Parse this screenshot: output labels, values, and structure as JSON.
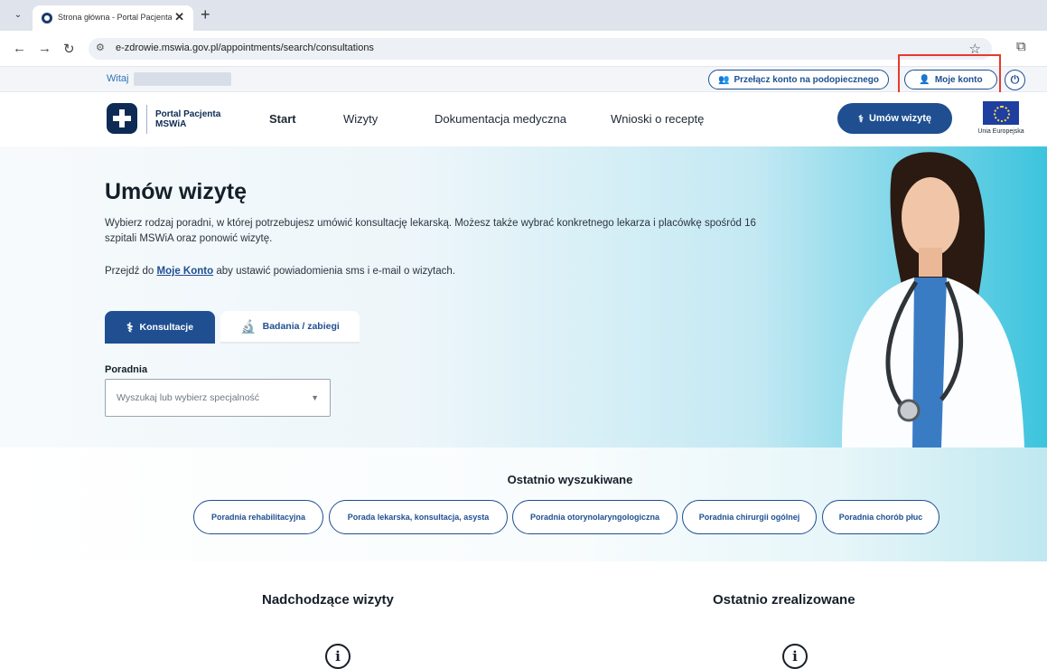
{
  "browser": {
    "tab_title": "Strona główna - Portal Pacjenta M",
    "tab_menu_glyph": "⌄",
    "close_glyph": "✕",
    "new_tab_glyph": "+",
    "back_glyph": "←",
    "forward_glyph": "→",
    "reload_glyph": "↻",
    "site_info_glyph": "⚙",
    "url": "e-zdrowie.mswia.gov.pl/appointments/search/consultations",
    "star_glyph": "☆",
    "extensions_glyph": "⧉"
  },
  "topbar": {
    "greeting": "Witaj",
    "switch_account_label": "Przełącz konto na podopiecznego",
    "switch_icon_glyph": "👥",
    "my_account_label": "Moje konto",
    "user_icon_glyph": "👤",
    "power_icon_glyph": "⏻"
  },
  "header": {
    "logo_text": "Portal Pacjenta MSWiA",
    "nav": {
      "start": "Start",
      "wizyty": "Wizyty",
      "dokumentacja": "Dokumentacja medyczna",
      "wnioski": "Wnioski o receptę"
    },
    "cta_label": "Umów wizytę",
    "stethoscope_glyph": "⚕",
    "eu_label": "Unia Europejska"
  },
  "hero": {
    "title": "Umów wizytę",
    "description": "Wybierz rodzaj poradni, w której potrzebujesz umówić konsultację lekarską. Możesz także wybrać konkretnego lekarza i placówkę spośród 16 szpitali MSWiA oraz ponowić wizytę.",
    "prompt_before": "Przejdź do ",
    "prompt_link": "Moje Konto",
    "prompt_after": " aby ustawić powiadomienia sms i e-mail o wizytach.",
    "tabs": {
      "consultations": "Konsultacje",
      "consultations_icon": "⚕",
      "tests": "Badania / zabiegi",
      "tests_icon": "🔬"
    },
    "field_label": "Poradnia",
    "select_placeholder": "Wyszukaj lub wybierz specjalność",
    "select_caret": "▼"
  },
  "recent": {
    "title": "Ostatnio wyszukiwane",
    "chips": [
      "Poradnia rehabilitacyjna",
      "Porada lekarska, konsultacja, asysta",
      "Poradnia otorynolaryngologiczna",
      "Poradnia chirurgii ogólnej",
      "Poradnia chorób płuc"
    ]
  },
  "lower": {
    "upcoming_title": "Nadchodzące wizyty",
    "completed_title": "Ostatnio zrealizowane",
    "info_glyph": "i"
  },
  "colors": {
    "primary": "#1f4f91",
    "logo_navy": "#0d2b55",
    "highlight": "#e63a2e",
    "hero_accent": "#3cc4de"
  }
}
